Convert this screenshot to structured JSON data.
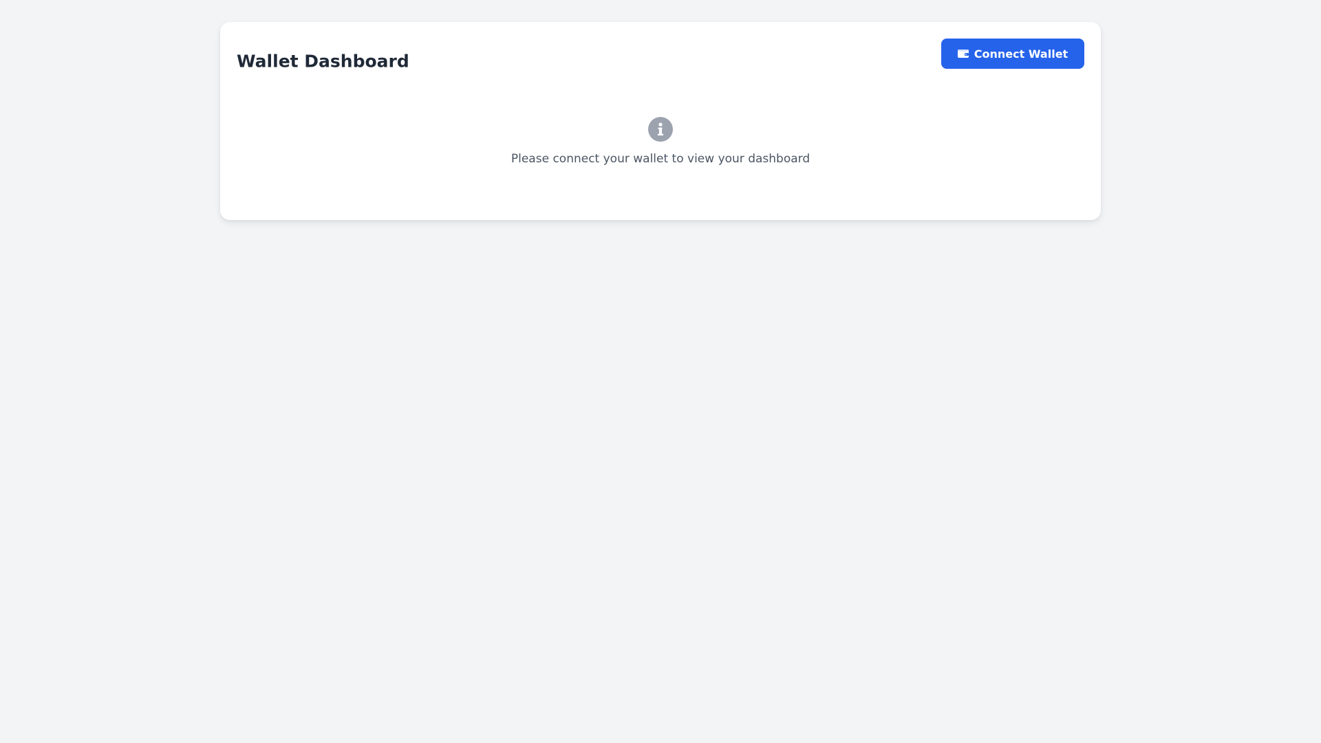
{
  "header": {
    "title": "Wallet Dashboard",
    "connect_label": "Connect Wallet",
    "connect_icon": "wallet-icon"
  },
  "empty_state": {
    "icon": "info-circle-icon",
    "message": "Please connect your wallet to view your dashboard"
  },
  "colors": {
    "accent": "#2563eb",
    "background": "#f3f4f6",
    "card": "#ffffff",
    "title": "#1f2937",
    "muted_text": "#4b5563",
    "icon_gray": "#9ca3af"
  }
}
